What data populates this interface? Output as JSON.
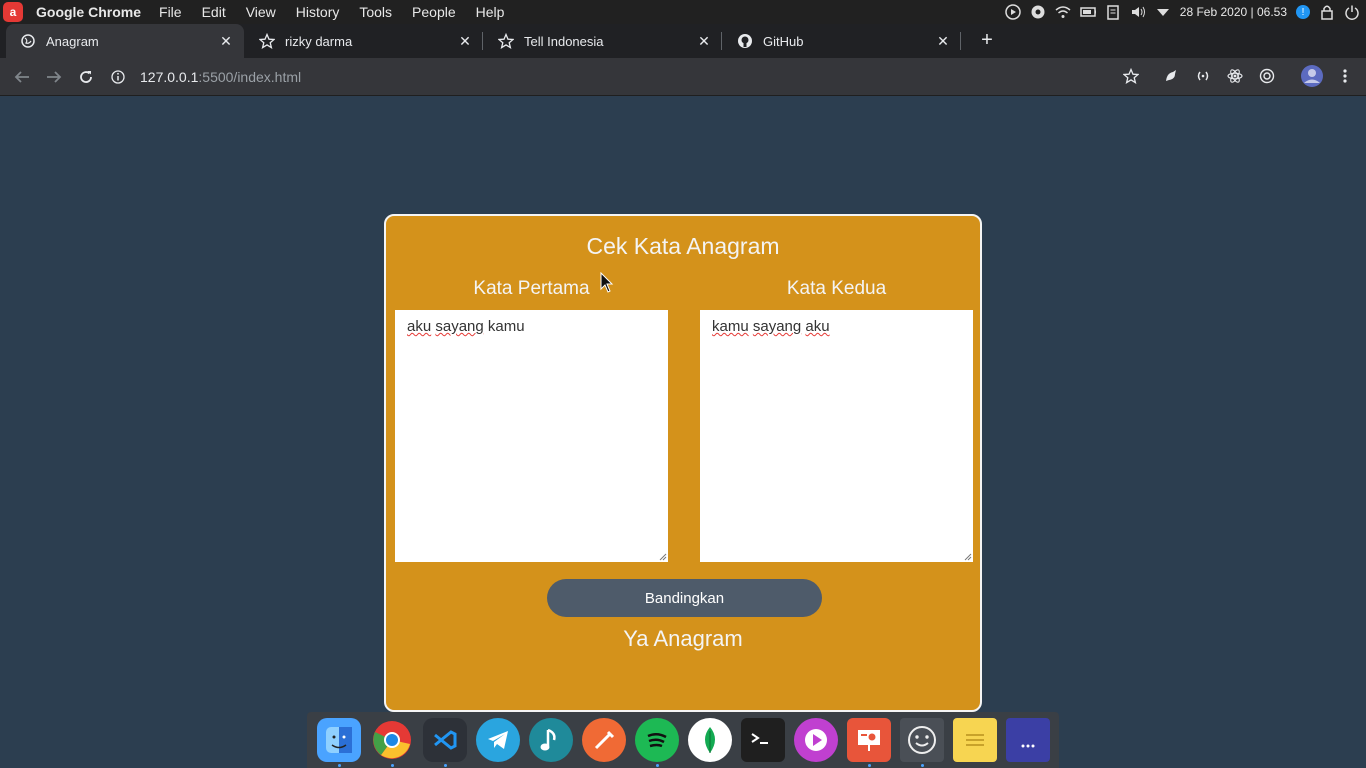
{
  "topbar": {
    "app_name": "Google Chrome",
    "menus": [
      "File",
      "Edit",
      "View",
      "History",
      "Tools",
      "People",
      "Help"
    ],
    "datetime": "28 Feb 2020 | 06.53",
    "badge": "!"
  },
  "tabs": [
    {
      "title": "Anagram",
      "icon": "globe-icon"
    },
    {
      "title": "rizky darma",
      "icon": "star-icon"
    },
    {
      "title": "Tell Indonesia",
      "icon": "star-icon"
    },
    {
      "title": "GitHub",
      "icon": "github-icon"
    }
  ],
  "toolbar": {
    "url_host": "127.0.0.1",
    "url_path": ":5500/index.html"
  },
  "page": {
    "title": "Cek Kata Anagram",
    "label_first": "Kata Pertama",
    "label_second": "Kata Kedua",
    "first_words": [
      "aku",
      "sayang",
      "kamu"
    ],
    "second_words": [
      "kamu",
      "sayang",
      "aku"
    ],
    "button_label": "Bandingkan",
    "result": "Ya Anagram"
  },
  "colors": {
    "background": "#2c3e50",
    "card": "#d4921b",
    "button": "#4e5b6a"
  },
  "dock": {
    "apps": [
      "finder-icon",
      "chrome-icon",
      "vscode-icon",
      "telegram-icon",
      "music-icon",
      "postman-icon",
      "spotify-icon",
      "mongodb-icon",
      "terminal-icon",
      "media-player-icon",
      "presentation-icon",
      "face-icon",
      "notes-icon",
      "launcher-icon"
    ]
  }
}
